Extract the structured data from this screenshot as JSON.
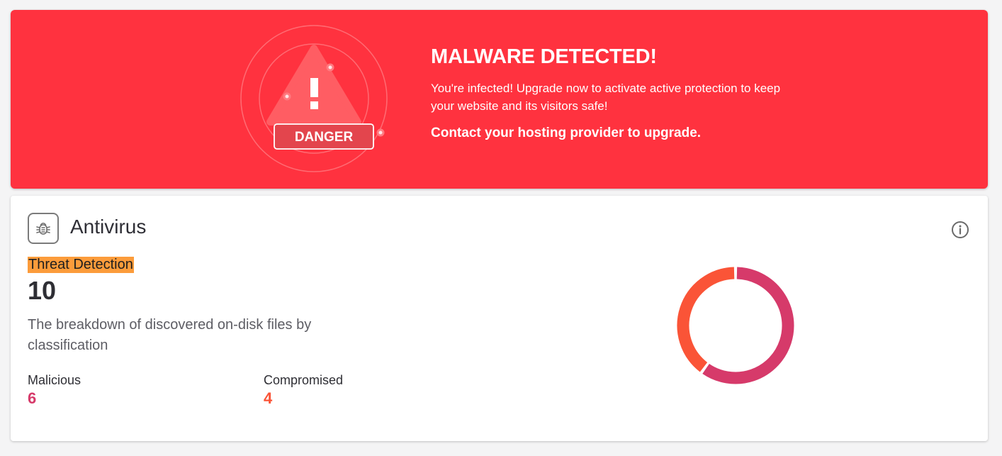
{
  "banner": {
    "badge": "DANGER",
    "title": "MALWARE DETECTED!",
    "message": "You're infected! Upgrade now to activate active protection to keep your website and its visitors safe!",
    "cta": "Contact your hosting provider to upgrade.",
    "background_color": "#ff323f"
  },
  "antivirus": {
    "icon": "bug-icon",
    "title": "Antivirus",
    "info_icon": "info-icon",
    "threat_label": "Threat Detection",
    "threat_count": "10",
    "description": "The breakdown of discovered on-disk files by classification",
    "stats": [
      {
        "label": "Malicious",
        "value": "6",
        "color": "#d63a6a"
      },
      {
        "label": "Compromised",
        "value": "4",
        "color": "#fa5437"
      }
    ]
  },
  "chart_data": {
    "type": "pie",
    "donut": true,
    "categories": [
      "Malicious",
      "Compromised"
    ],
    "values": [
      6,
      4
    ],
    "colors": [
      "#d63a6a",
      "#fa5437"
    ]
  }
}
